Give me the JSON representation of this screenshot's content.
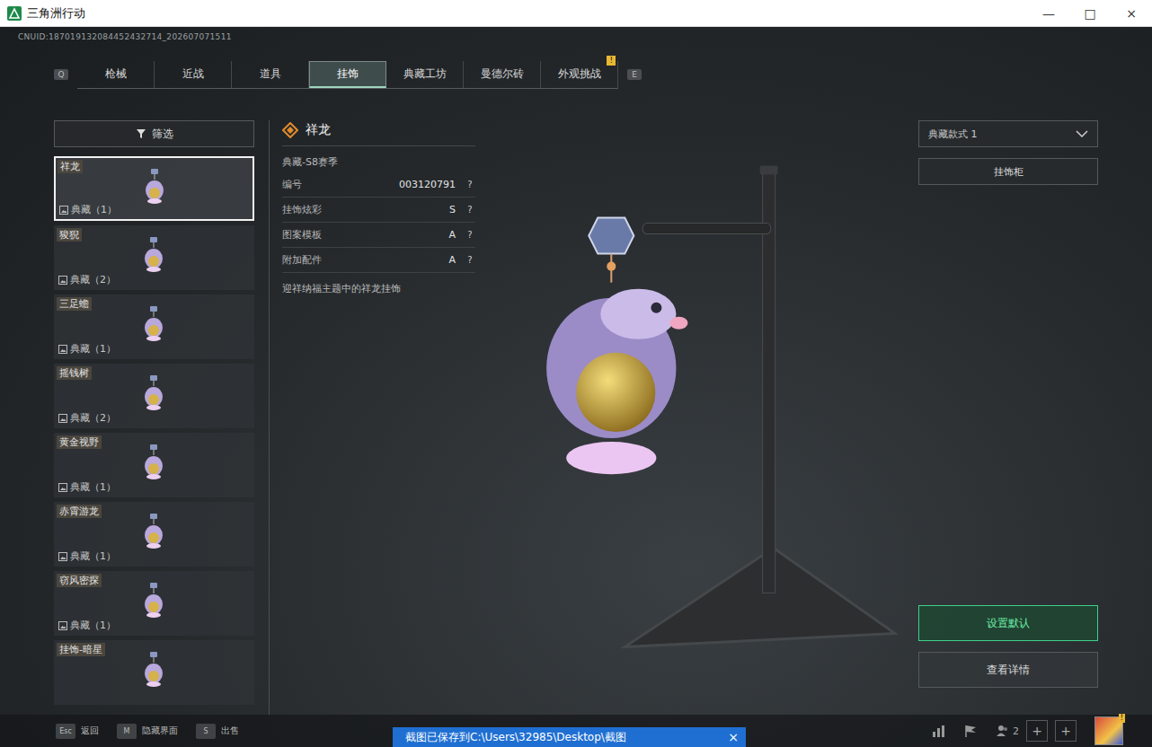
{
  "window": {
    "title": "三角洲行动",
    "controls": [
      "—",
      "□",
      "×"
    ]
  },
  "uid": "CNUID:187019132084452432714_202607071511",
  "tabs": {
    "prev_key": "Q",
    "next_key": "E",
    "items": [
      {
        "label": "枪械",
        "selected": false,
        "badge": null
      },
      {
        "label": "近战",
        "selected": false,
        "badge": null
      },
      {
        "label": "道具",
        "selected": false,
        "badge": null
      },
      {
        "label": "挂饰",
        "selected": true,
        "badge": null
      },
      {
        "label": "典藏工坊",
        "selected": false,
        "badge": null
      },
      {
        "label": "曼德尔砖",
        "selected": false,
        "badge": null
      },
      {
        "label": "外观挑战",
        "selected": false,
        "badge": "!"
      }
    ]
  },
  "filter": {
    "label": "筛选"
  },
  "items": [
    {
      "name": "祥龙",
      "count": "典藏（1）",
      "selected": true
    },
    {
      "name": "狻猊",
      "count": "典藏（2）",
      "selected": false
    },
    {
      "name": "三足蟾",
      "count": "典藏（1）",
      "selected": false
    },
    {
      "name": "摇钱树",
      "count": "典藏（2）",
      "selected": false
    },
    {
      "name": "黄金视野",
      "count": "典藏（1）",
      "selected": false
    },
    {
      "name": "赤霄游龙",
      "count": "典藏（1）",
      "selected": false
    },
    {
      "name": "窃风密探",
      "count": "典藏（1）",
      "selected": false
    },
    {
      "name": "挂饰-暗星",
      "count": null,
      "selected": false
    }
  ],
  "detail": {
    "title": "祥龙",
    "season": "典藏-S8赛季",
    "attributes": [
      {
        "label": "编号",
        "value": "003120791",
        "help": "?"
      },
      {
        "label": "挂饰炫彩",
        "value": "S",
        "help": "?"
      },
      {
        "label": "图案模板",
        "value": "A",
        "help": "?"
      },
      {
        "label": "附加配件",
        "value": "A",
        "help": "?"
      }
    ],
    "description": "迎祥纳福主题中的祥龙挂饰"
  },
  "variant_select": {
    "value": "典藏款式 1"
  },
  "cabinet_button": "挂饰柜",
  "actions": [
    {
      "label": "设置默认",
      "primary": true
    },
    {
      "label": "查看详情",
      "primary": false
    }
  ],
  "key_hints": [
    {
      "key": "Esc",
      "label": "返回"
    },
    {
      "key": "M",
      "label": "隐藏界面"
    },
    {
      "key": "S",
      "label": "出售"
    }
  ],
  "hud": {
    "friends_count": "2",
    "plus": [
      "+",
      "+"
    ],
    "avatar_badge": "!"
  },
  "toast": {
    "text": "截图已保存到C:\\Users\\32985\\Desktop\\截图",
    "close": "×"
  }
}
